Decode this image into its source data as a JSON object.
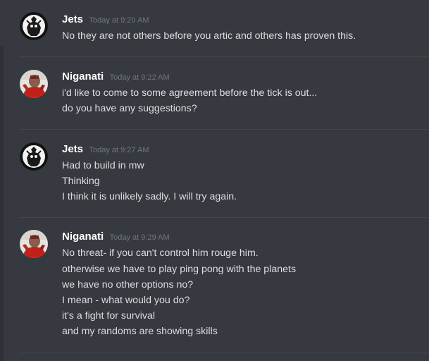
{
  "messages": [
    {
      "author": "Jets",
      "timestamp": "Today at 9:20 AM",
      "avatar_icon": "robot-sketch-avatar",
      "lines": [
        "No they are not others before you artic and others has proven this."
      ]
    },
    {
      "author": "Niganati",
      "timestamp": "Today at 9:22 AM",
      "avatar_icon": "red-photo-avatar",
      "lines": [
        "i'd like to come to some agreement before the tick is out...",
        "do you have any suggestions?"
      ]
    },
    {
      "author": "Jets",
      "timestamp": "Today at 9:27 AM",
      "avatar_icon": "robot-sketch-avatar",
      "lines": [
        "Had to build in mw",
        "Thinking",
        "I think it is unlikely sadly. I will try again."
      ]
    },
    {
      "author": "Niganati",
      "timestamp": "Today at 9:29 AM",
      "avatar_icon": "red-photo-avatar",
      "lines": [
        "No threat- if you can't control him rouge him.",
        "otherwise we have to play ping pong with the planets",
        "we have no other options no?",
        "I mean - what would you do?",
        "it's a fight for survival",
        "and my randoms are showing skills"
      ]
    }
  ],
  "colors": {
    "background": "#36393f",
    "username": "#ffffff",
    "timestamp": "#72767d",
    "text": "#dcddde",
    "divider": "#42454a"
  }
}
